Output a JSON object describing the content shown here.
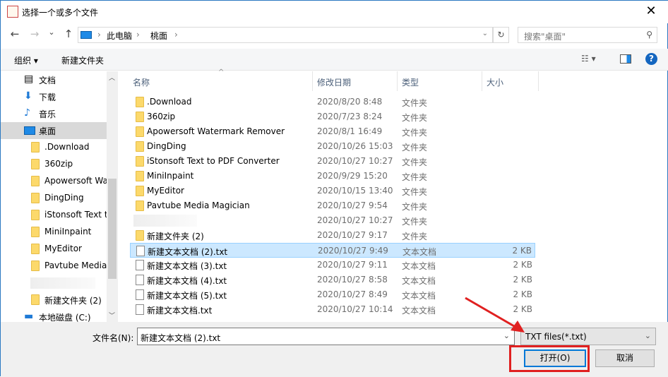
{
  "window": {
    "title": "选择一个或多个文件",
    "close": "✕"
  },
  "nav": {
    "back": "←",
    "forward": "→",
    "recent": "⌄",
    "up": "↑",
    "breadcrumb": [
      "此电脑",
      "桃面"
    ],
    "search_placeholder": "搜索\"桌面\""
  },
  "toolbar": {
    "organize": "组织 ▾",
    "new_folder": "新建文件夹",
    "help": "?"
  },
  "sidebar": {
    "items": [
      {
        "label": "文档",
        "icon": "document-icon"
      },
      {
        "label": "下载",
        "icon": "download-icon"
      },
      {
        "label": "音乐",
        "icon": "music-icon"
      },
      {
        "label": "桌面",
        "icon": "desktop-icon"
      },
      {
        "label": ".Download"
      },
      {
        "label": "360zip"
      },
      {
        "label": "Apowersoft Watermark Remover"
      },
      {
        "label": "DingDing"
      },
      {
        "label": "iStonsoft Text to PDF Converter"
      },
      {
        "label": "MiniInpaint"
      },
      {
        "label": "MyEditor"
      },
      {
        "label": "Pavtube Media Magician"
      },
      {
        "label": ""
      },
      {
        "label": "新建文件夹 (2)"
      },
      {
        "label": "本地磁盘 (C:)",
        "icon": "drive-icon"
      }
    ]
  },
  "columns": {
    "name": "名称",
    "date": "修改日期",
    "type": "类型",
    "size": "大小"
  },
  "files": [
    {
      "name": ".Download",
      "date": "2020/8/20 8:48",
      "type": "文件夹",
      "size": "",
      "kind": "folder"
    },
    {
      "name": "360zip",
      "date": "2020/7/23 8:24",
      "type": "文件夹",
      "size": "",
      "kind": "folder"
    },
    {
      "name": "Apowersoft Watermark Remover",
      "date": "2020/8/1 16:49",
      "type": "文件夹",
      "size": "",
      "kind": "folder"
    },
    {
      "name": "DingDing",
      "date": "2020/10/26 15:03",
      "type": "文件夹",
      "size": "",
      "kind": "folder"
    },
    {
      "name": "iStonsoft Text to PDF Converter",
      "date": "2020/10/27 10:27",
      "type": "文件夹",
      "size": "",
      "kind": "folder"
    },
    {
      "name": "MiniInpaint",
      "date": "2020/9/29 15:20",
      "type": "文件夹",
      "size": "",
      "kind": "folder"
    },
    {
      "name": "MyEditor",
      "date": "2020/10/15 13:40",
      "type": "文件夹",
      "size": "",
      "kind": "folder"
    },
    {
      "name": "Pavtube Media Magician",
      "date": "2020/10/27 9:54",
      "type": "文件夹",
      "size": "",
      "kind": "folder"
    },
    {
      "name": "",
      "date": "2020/10/27 10:27",
      "type": "文件夹",
      "size": "",
      "kind": "blurred"
    },
    {
      "name": "新建文件夹 (2)",
      "date": "2020/10/27 9:17",
      "type": "文件夹",
      "size": "",
      "kind": "folder"
    },
    {
      "name": "新建文本文档 (2).txt",
      "date": "2020/10/27 9:49",
      "type": "文本文档",
      "size": "2 KB",
      "kind": "doc",
      "selected": true
    },
    {
      "name": "新建文本文档 (3).txt",
      "date": "2020/10/27 9:11",
      "type": "文本文档",
      "size": "2 KB",
      "kind": "doc"
    },
    {
      "name": "新建文本文档 (4).txt",
      "date": "2020/10/27 8:58",
      "type": "文本文档",
      "size": "2 KB",
      "kind": "doc"
    },
    {
      "name": "新建文本文档 (5).txt",
      "date": "2020/10/27 8:49",
      "type": "文本文档",
      "size": "2 KB",
      "kind": "doc"
    },
    {
      "name": "新建文本文档.txt",
      "date": "2020/10/27 10:14",
      "type": "文本文档",
      "size": "2 KB",
      "kind": "doc"
    }
  ],
  "footer": {
    "filename_label": "文件名(N):",
    "filename_value": "新建文本文档 (2).txt",
    "filter": "TXT files(*.txt)",
    "open": "打开(O)",
    "cancel": "取消"
  }
}
